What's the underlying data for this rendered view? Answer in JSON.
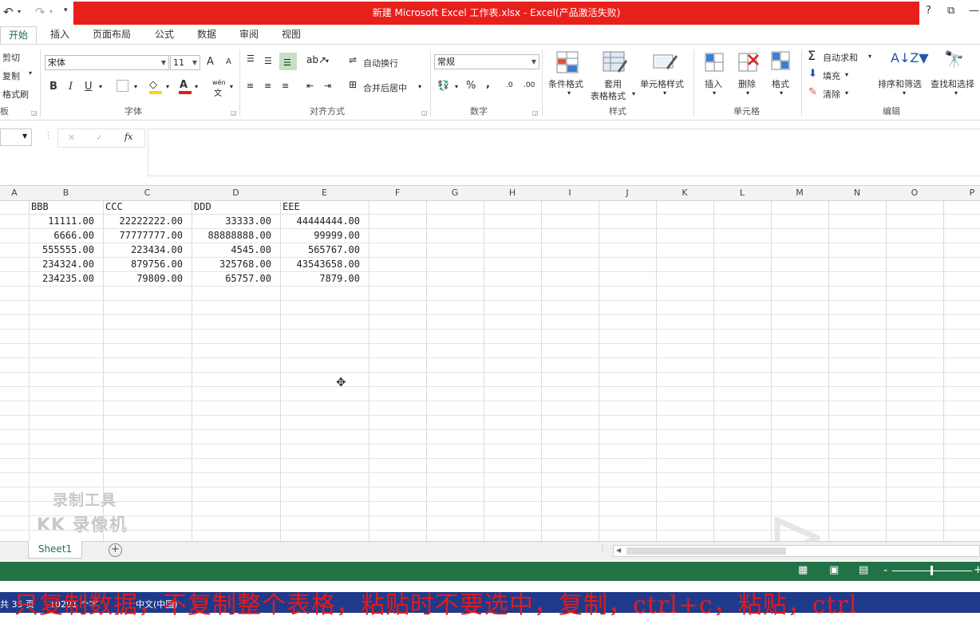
{
  "window": {
    "title": "新建 Microsoft Excel 工作表.xlsx -  Excel(产品激活失败)",
    "help": "?",
    "restore": "⧉",
    "minimize": "—"
  },
  "qat": {
    "undo": "↶",
    "redo": "↷"
  },
  "tabs": [
    "开始",
    "插入",
    "页面布局",
    "公式",
    "数据",
    "审阅",
    "视图"
  ],
  "clipboard": {
    "cut": "剪切",
    "copy": "复制",
    "format_painter": "格式刷",
    "group": "板"
  },
  "font": {
    "name": "宋体",
    "size": "11",
    "group": "字体",
    "bold": "B",
    "italic": "I",
    "underline": "U",
    "grow": "A",
    "shrink": "A",
    "phonetic": "wén"
  },
  "alignment": {
    "wrap": "自动换行",
    "merge": "合并后居中",
    "group": "对齐方式"
  },
  "number": {
    "format": "常规",
    "group": "数字",
    "percent": "%",
    "comma": ",",
    "inc": ".0",
    "dec": ".00"
  },
  "styles": {
    "conditional": "条件格式",
    "table_line1": "套用",
    "table_line2": "表格格式",
    "cell_styles": "单元格样式",
    "group": "样式"
  },
  "cells": {
    "insert": "插入",
    "delete": "删除",
    "format": "格式",
    "group": "单元格"
  },
  "editing": {
    "autosum": "自动求和",
    "fill": "填充",
    "clear": "清除",
    "sort": "排序和筛选",
    "find": "查找和选择",
    "group": "编辑"
  },
  "formula_bar": {
    "name_box": "",
    "cancel": "✕",
    "enter": "✓",
    "fx": "fx",
    "content": ""
  },
  "columns": [
    "A",
    "B",
    "C",
    "D",
    "E",
    "F",
    "G",
    "H",
    "I",
    "J",
    "K",
    "L",
    "M",
    "N",
    "O",
    "P"
  ],
  "table": {
    "headers": [
      "BBB",
      "CCC",
      "DDD",
      "EEE"
    ],
    "rows": [
      [
        "11111.00",
        "22222222.00",
        "33333.00",
        "44444444.00"
      ],
      [
        "6666.00",
        "77777777.00",
        "88888888.00",
        "99999.00"
      ],
      [
        "555555.00",
        "223434.00",
        "4545.00",
        "565767.00"
      ],
      [
        "234324.00",
        "879756.00",
        "325768.00",
        "43543658.00"
      ],
      [
        "234235.00",
        "79809.00",
        "65757.00",
        "7879.00"
      ]
    ]
  },
  "sheet_tab": "Sheet1",
  "add_sheet": "+",
  "watermark": {
    "line1": "录制工具",
    "line2": "KK 录像机"
  },
  "status": {
    "zoom_minus": "-",
    "zoom_plus": "+"
  },
  "taskbar": {
    "page": "共 35 页",
    "words": "10291 个字",
    "lang": "中文(中国)"
  },
  "subtitle": "只复制数据，不复制整个表格，粘贴时不要选中，复制，ctrl+c，粘贴，ctrl"
}
